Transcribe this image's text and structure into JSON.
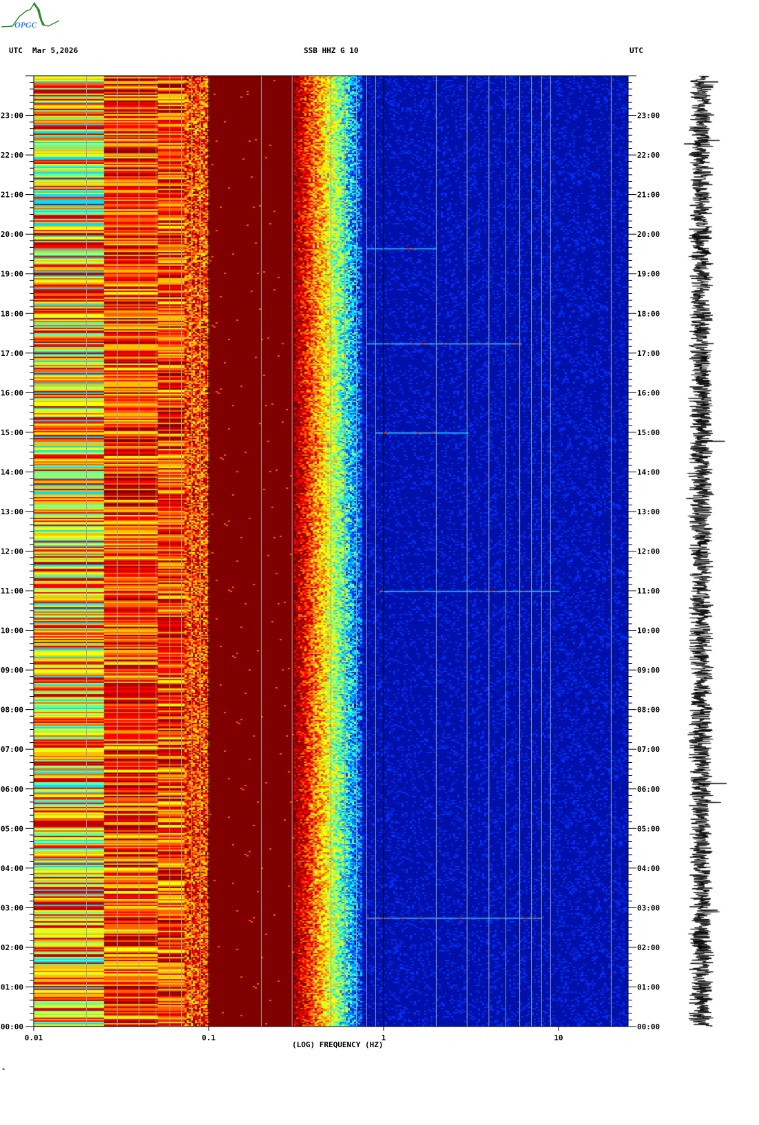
{
  "header": {
    "logo_text": "OPGC",
    "left_tz": "UTC",
    "date": "Mar 5,2026",
    "station": "SSB HHZ G 10",
    "right_tz": "UTC"
  },
  "footer": {
    "mark": "*"
  },
  "chart_data": {
    "type": "heatmap",
    "title": "SSB HHZ G 10",
    "xlabel": "(LOG) FREQUENCY (HZ)",
    "x_scale": "log",
    "xlim": [
      0.01,
      25
    ],
    "x_ticks": [
      {
        "value": 0.01,
        "label": "0.01"
      },
      {
        "value": 0.1,
        "label": "0.1"
      },
      {
        "value": 1,
        "label": "1"
      },
      {
        "value": 10,
        "label": "10"
      }
    ],
    "x_gridlines": [
      0.02,
      0.03,
      0.04,
      0.05,
      0.06,
      0.07,
      0.08,
      0.09,
      0.2,
      0.3,
      0.4,
      0.5,
      0.6,
      0.7,
      0.8,
      0.9,
      2,
      3,
      4,
      5,
      6,
      7,
      8,
      9,
      20
    ],
    "ylabel": "UTC",
    "ylim_hours": [
      0,
      24
    ],
    "y_ticks": [
      {
        "hour": 0,
        "label": "00:00"
      },
      {
        "hour": 1,
        "label": "01:00"
      },
      {
        "hour": 2,
        "label": "02:00"
      },
      {
        "hour": 3,
        "label": "03:00"
      },
      {
        "hour": 4,
        "label": "04:00"
      },
      {
        "hour": 5,
        "label": "05:00"
      },
      {
        "hour": 6,
        "label": "06:00"
      },
      {
        "hour": 7,
        "label": "07:00"
      },
      {
        "hour": 8,
        "label": "08:00"
      },
      {
        "hour": 9,
        "label": "09:00"
      },
      {
        "hour": 10,
        "label": "10:00"
      },
      {
        "hour": 11,
        "label": "11:00"
      },
      {
        "hour": 12,
        "label": "12:00"
      },
      {
        "hour": 13,
        "label": "13:00"
      },
      {
        "hour": 14,
        "label": "14:00"
      },
      {
        "hour": 15,
        "label": "15:00"
      },
      {
        "hour": 16,
        "label": "16:00"
      },
      {
        "hour": 17,
        "label": "17:00"
      },
      {
        "hour": 18,
        "label": "18:00"
      },
      {
        "hour": 19,
        "label": "19:00"
      },
      {
        "hour": 20,
        "label": "20:00"
      },
      {
        "hour": 21,
        "label": "21:00"
      },
      {
        "hour": 22,
        "label": "22:00"
      },
      {
        "hour": 23,
        "label": "23:00"
      }
    ],
    "bands": [
      {
        "fmin": 0.01,
        "fmax": 0.025,
        "level": "high-mixed (yellow/cyan/orange/red)"
      },
      {
        "fmin": 0.025,
        "fmax": 0.1,
        "level": "high (yellow/orange/red)"
      },
      {
        "fmin": 0.1,
        "fmax": 0.3,
        "level": "saturated (dark red)"
      },
      {
        "fmin": 0.3,
        "fmax": 0.7,
        "level": "transition (red→yellow→cyan→blue)"
      },
      {
        "fmin": 0.7,
        "fmax": 25,
        "level": "low (dark blue)"
      }
    ],
    "events": [
      {
        "hour": 11.0,
        "fmin": 0.95,
        "fmax": 10
      },
      {
        "hour": 17.25,
        "fmin": 0.8,
        "fmax": 6
      },
      {
        "hour": 2.75,
        "fmin": 0.8,
        "fmax": 8
      },
      {
        "hour": 19.65,
        "fmin": 0.8,
        "fmax": 2
      },
      {
        "hour": 15.0,
        "fmin": 0.9,
        "fmax": 3
      }
    ],
    "colors": {
      "saturated": "#800000",
      "low": "#0010a8",
      "grid": "#a0a0a0"
    }
  }
}
